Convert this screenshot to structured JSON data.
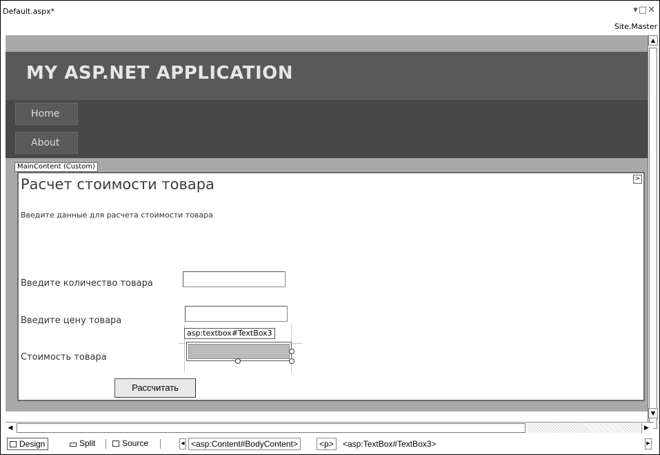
{
  "document": {
    "tab_title": "Default.aspx*",
    "window_controls": "▾□✕",
    "master_page": "Site.Master"
  },
  "site": {
    "title": "MY ASP.NET APPLICATION",
    "menu": [
      {
        "label": "Home"
      },
      {
        "label": "About"
      }
    ]
  },
  "content_region": {
    "tag": "MainContent (Custom)",
    "smart_tag_glyph": ">"
  },
  "form": {
    "heading": "Расчет стоимости товара",
    "intro": "Введите данные для расчета стоимости товара",
    "quantity_label": "Введите количество товара",
    "quantity_value": "",
    "price_label": "Введите цену товара",
    "price_value": "",
    "cost_label": "Стоимость товара",
    "cost_value": "",
    "selected_control_tag": "asp:textbox#TextBox3",
    "calculate_button": "Рассчитать"
  },
  "bottom_bar": {
    "views": [
      {
        "label": "Design",
        "active": true
      },
      {
        "label": "Split",
        "active": false
      },
      {
        "label": "Source",
        "active": false
      }
    ],
    "breadcrumb": [
      {
        "label": "<asp:Content#BodyContent>",
        "boxed": true
      },
      {
        "label": "<p>",
        "boxed": true
      },
      {
        "label": "<asp:TextBox#TextBox3>",
        "boxed": false
      }
    ]
  },
  "colors": {
    "surface": "#a9a9a9",
    "header": "#595959",
    "menu_band": "#484848",
    "selected_textbox_fill": "#bdbdbd"
  }
}
